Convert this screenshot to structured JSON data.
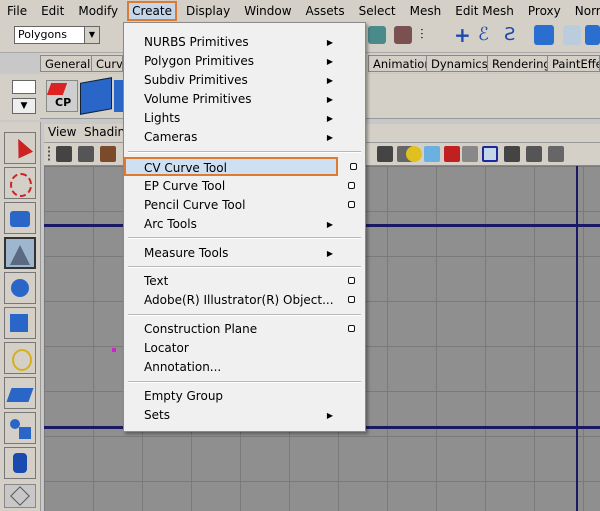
{
  "menubar": {
    "items": [
      "File",
      "Edit",
      "Modify",
      "Create",
      "Display",
      "Window",
      "Assets",
      "Select",
      "Mesh",
      "Edit Mesh",
      "Proxy",
      "Normals"
    ],
    "active": "Create"
  },
  "status_line": {
    "mode_dropdown": "Polygons"
  },
  "shelf_tabs": [
    "General",
    "Curve",
    "Animation",
    "Dynamics",
    "Rendering",
    "PaintEffe"
  ],
  "shelf": {
    "cp_label": "CP"
  },
  "panel_menu": {
    "view": "View",
    "shading": "Shadin"
  },
  "create_menu": {
    "items": [
      {
        "label": "NURBS Primitives",
        "submenu": true
      },
      {
        "label": "Polygon Primitives",
        "submenu": true
      },
      {
        "label": "Subdiv Primitives",
        "submenu": true
      },
      {
        "label": "Volume Primitives",
        "submenu": true
      },
      {
        "label": "Lights",
        "submenu": true
      },
      {
        "label": "Cameras",
        "submenu": true
      },
      {
        "label": "CV Curve Tool",
        "option_box": true,
        "highlighted": true
      },
      {
        "label": "EP Curve Tool",
        "option_box": true
      },
      {
        "label": "Pencil Curve Tool",
        "option_box": true
      },
      {
        "label": "Arc Tools",
        "submenu": true
      },
      {
        "label": "Measure Tools",
        "submenu": true
      },
      {
        "label": "Text",
        "option_box": true
      },
      {
        "label": "Adobe(R) Illustrator(R) Object...",
        "option_box": true
      },
      {
        "label": "Construction Plane",
        "option_box": true
      },
      {
        "label": "Locator"
      },
      {
        "label": "Annotation..."
      },
      {
        "label": "Empty Group"
      },
      {
        "label": "Sets",
        "submenu": true
      }
    ]
  },
  "colors": {
    "highlight_border": "#e07a30",
    "highlight_fill": "#cfe0f3",
    "grid_axis": "#1a1a64"
  }
}
